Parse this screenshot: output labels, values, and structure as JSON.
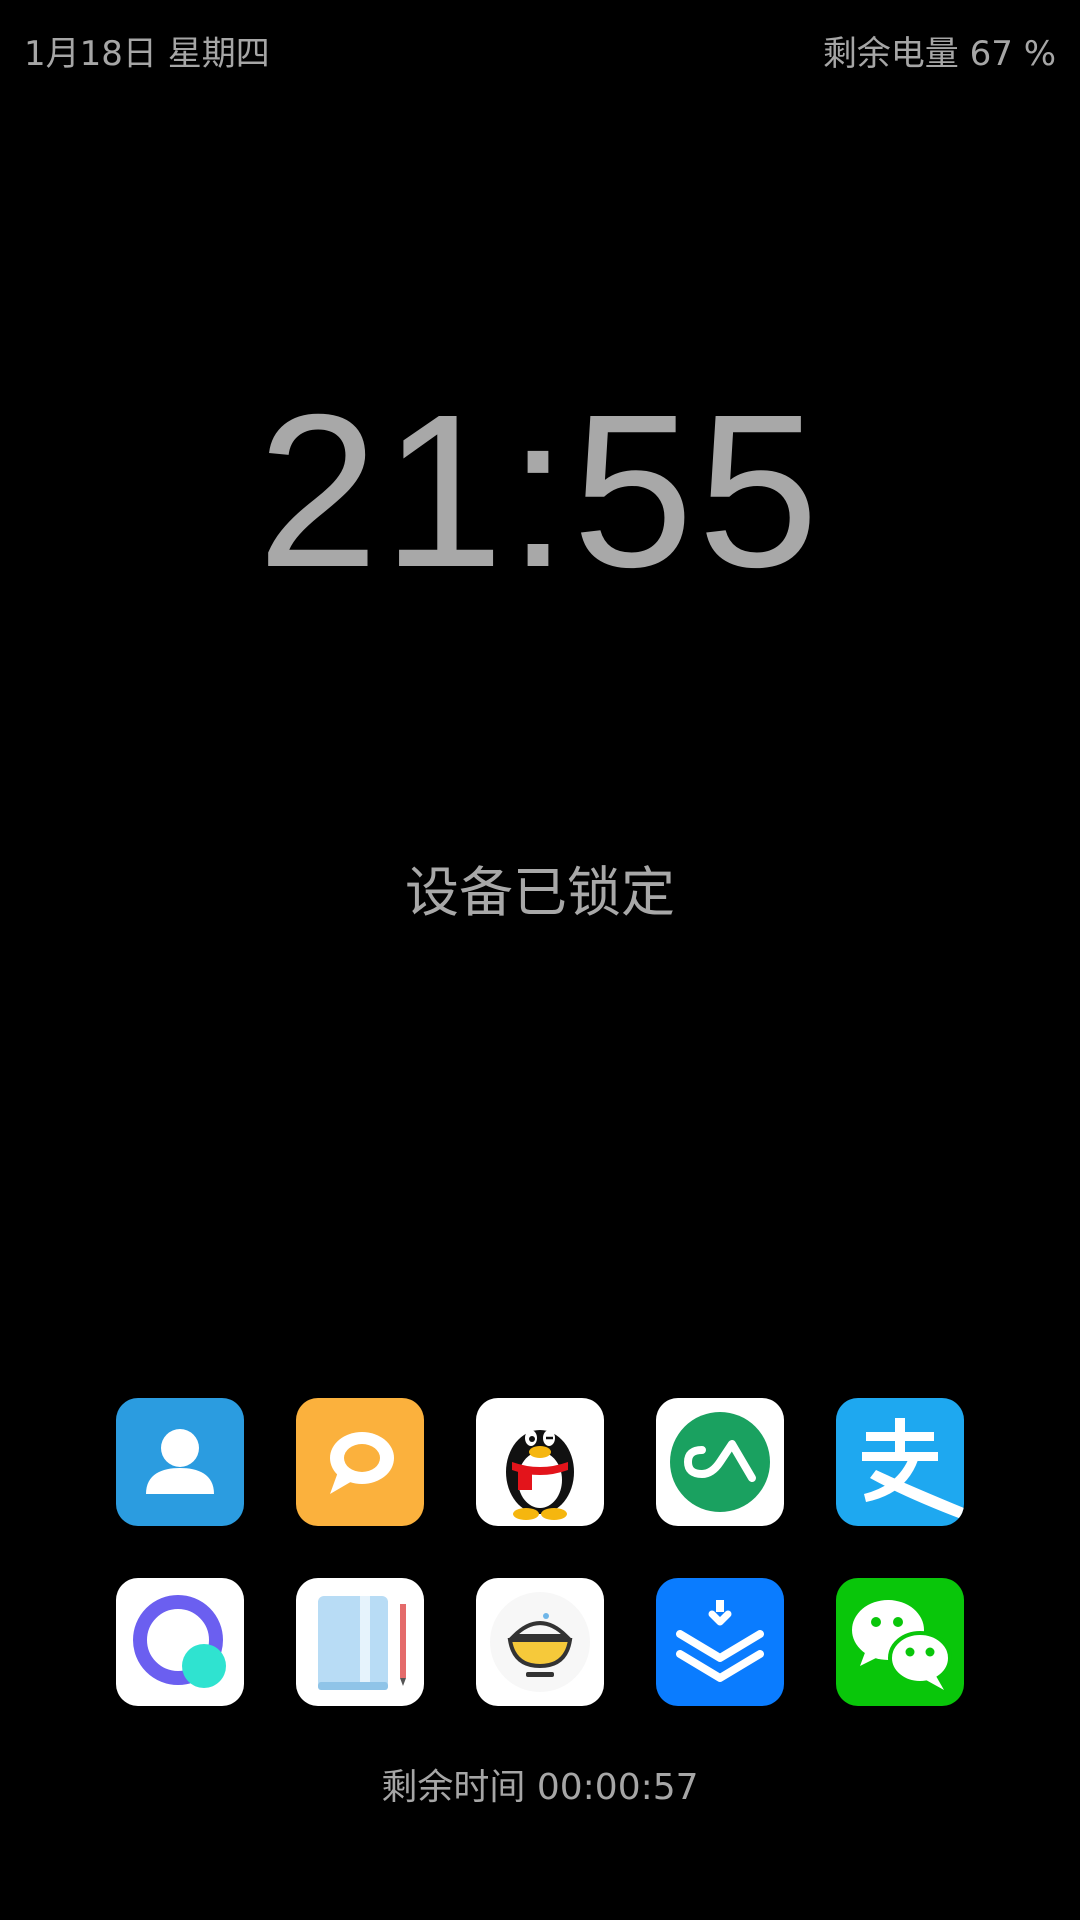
{
  "status_bar": {
    "date": "1月18日 星期四",
    "battery": "剩余电量 67 %"
  },
  "clock": {
    "time": "21:55"
  },
  "lock_status": "设备已锁定",
  "apps": [
    {
      "icon": "contacts-icon",
      "color": "#2b9ce0"
    },
    {
      "icon": "messages-icon",
      "color": "#fbb13d"
    },
    {
      "icon": "qq-penguin-icon",
      "color": "#ffffff"
    },
    {
      "icon": "green-a-app-icon",
      "color": "#1aa160"
    },
    {
      "icon": "alipay-icon",
      "color": "#1ea8f0"
    },
    {
      "icon": "purple-circle-app-icon",
      "color": "#6b5ff0"
    },
    {
      "icon": "notebook-icon",
      "color": "#b8dcf5"
    },
    {
      "icon": "rice-bowl-app-icon",
      "color": "#f6c93a"
    },
    {
      "icon": "blue-chevron-app-icon",
      "color": "#0a7cff"
    },
    {
      "icon": "wechat-icon",
      "color": "#09c60a"
    }
  ],
  "countdown": "剩余时间 00:00:57"
}
